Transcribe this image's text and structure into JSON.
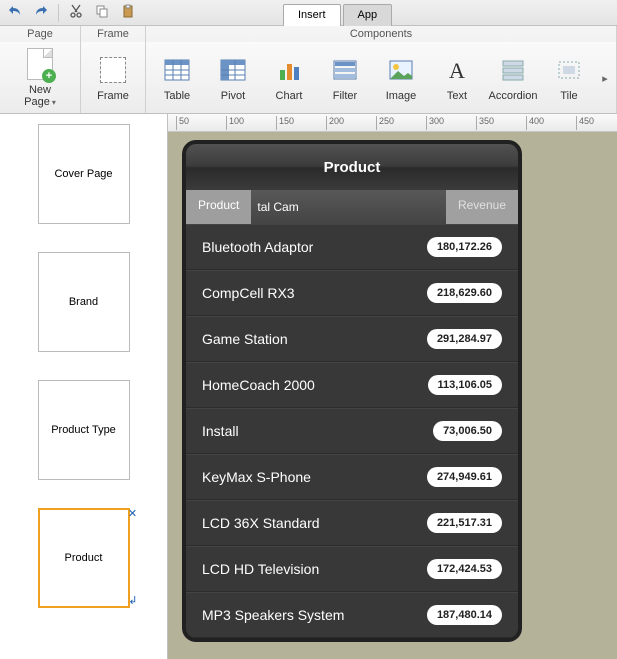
{
  "qat": {
    "undo": "undo",
    "redo": "redo",
    "cut": "cut",
    "copy": "copy",
    "paste": "paste"
  },
  "tabs": {
    "insert": "Insert",
    "app": "App"
  },
  "ribbon": {
    "page_group": "Page",
    "frame_group": "Frame",
    "components_group": "Components",
    "new_page": "New Page",
    "frame": "Frame",
    "table": "Table",
    "pivot": "Pivot",
    "chart": "Chart",
    "filter": "Filter",
    "image": "Image",
    "text": "Text",
    "accordion": "Accordion",
    "tile": "Tile"
  },
  "ruler": {
    "ticks": [
      "50",
      "100",
      "150",
      "200",
      "250",
      "300",
      "350",
      "400",
      "450"
    ]
  },
  "thumbs": [
    {
      "label": "Cover Page"
    },
    {
      "label": "Brand"
    },
    {
      "label": "Product Type"
    },
    {
      "label": "Product"
    }
  ],
  "panel": {
    "title": "Product",
    "drag_label": "Product",
    "mid_label": "tal Cam",
    "revenue_label": "Revenue",
    "rows": [
      {
        "name": "Bluetooth Adaptor",
        "value": "180,172.26"
      },
      {
        "name": "CompCell RX3",
        "value": "218,629.60"
      },
      {
        "name": "Game Station",
        "value": "291,284.97"
      },
      {
        "name": "HomeCoach 2000",
        "value": "113,106.05"
      },
      {
        "name": "Install",
        "value": "73,006.50"
      },
      {
        "name": "KeyMax S-Phone",
        "value": "274,949.61"
      },
      {
        "name": "LCD 36X Standard",
        "value": "221,517.31"
      },
      {
        "name": "LCD HD Television",
        "value": "172,424.53"
      },
      {
        "name": "MP3 Speakers System",
        "value": "187,480.14"
      }
    ]
  }
}
